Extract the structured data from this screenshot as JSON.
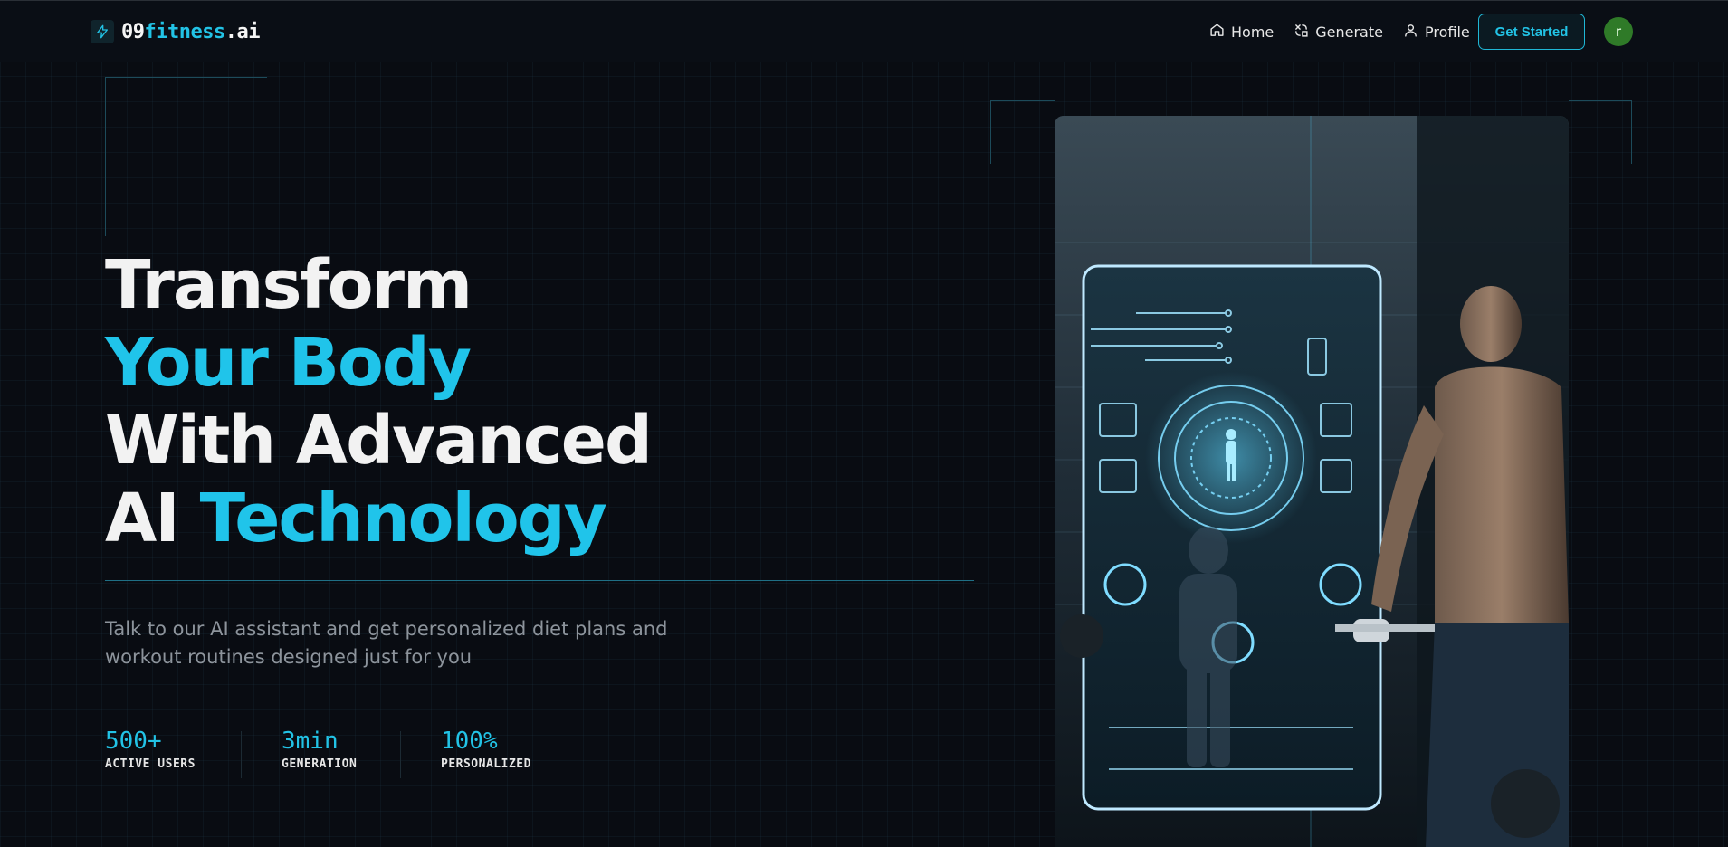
{
  "brand": {
    "logo_icon": "bolt-icon",
    "name_part1": "09",
    "name_part2": "fitness",
    "name_part3": ".ai"
  },
  "nav": {
    "items": [
      {
        "label": "Home",
        "icon": "home-icon"
      },
      {
        "label": "Generate",
        "icon": "generate-icon"
      },
      {
        "label": "Profile",
        "icon": "user-icon"
      }
    ],
    "cta_label": "Get Started",
    "avatar_initial": "r"
  },
  "hero": {
    "title_line1": "Transform",
    "title_line2": "Your Body",
    "title_line3": "With Advanced",
    "title_line4_a": "AI ",
    "title_line4_b": "Technology",
    "subtitle": "Talk to our AI assistant and get personalized diet plans and workout routines designed just for you"
  },
  "stats": [
    {
      "value": "500+",
      "label": "ACTIVE USERS"
    },
    {
      "value": "3min",
      "label": "GENERATION"
    },
    {
      "value": "100%",
      "label": "PERSONALIZED"
    }
  ],
  "image": {
    "subject": "man-at-smart-mirror-illustration"
  },
  "colors": {
    "background": "#090c12",
    "accent": "#22c3e6",
    "text": "#f2f2f2",
    "muted": "#8d949c",
    "avatar": "#2f7a28"
  }
}
